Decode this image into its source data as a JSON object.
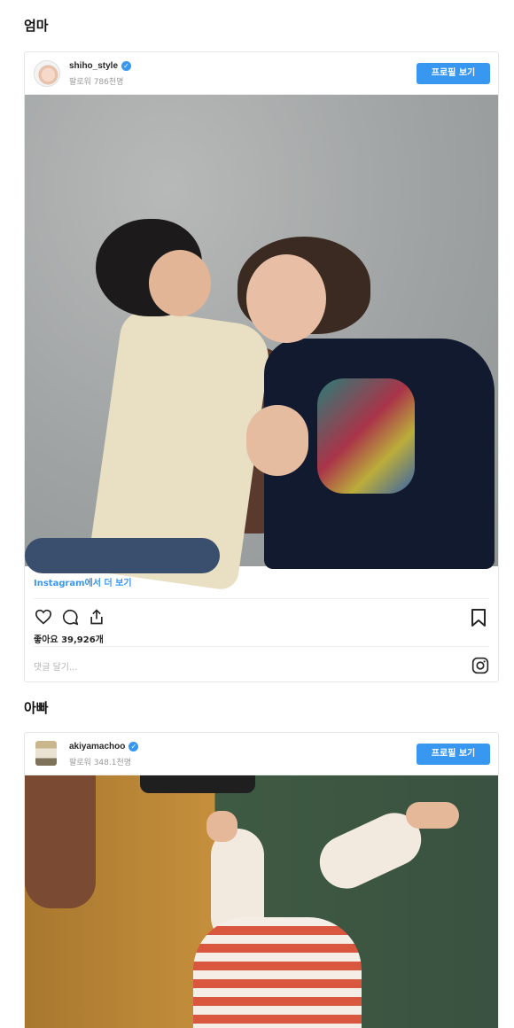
{
  "sections": {
    "mom_title": "엄마",
    "dad_title": "아빠"
  },
  "post1": {
    "username": "shiho_style",
    "followers": "팔로워 786천명",
    "profile_button": "프로필 보기",
    "more_link": "Instagram에서 더 보기",
    "likes": "좋아요 39,926개",
    "comment_placeholder": "댓글 달기...",
    "icons": [
      "heart-icon",
      "comment-icon",
      "share-icon",
      "bookmark-icon",
      "instagram-icon"
    ]
  },
  "post2": {
    "username": "akiyamachoo",
    "followers": "팔로워 348.1천명",
    "profile_button": "프로필 보기"
  },
  "colors": {
    "accent": "#3897f0",
    "text": "#262626",
    "muted": "#999999"
  }
}
